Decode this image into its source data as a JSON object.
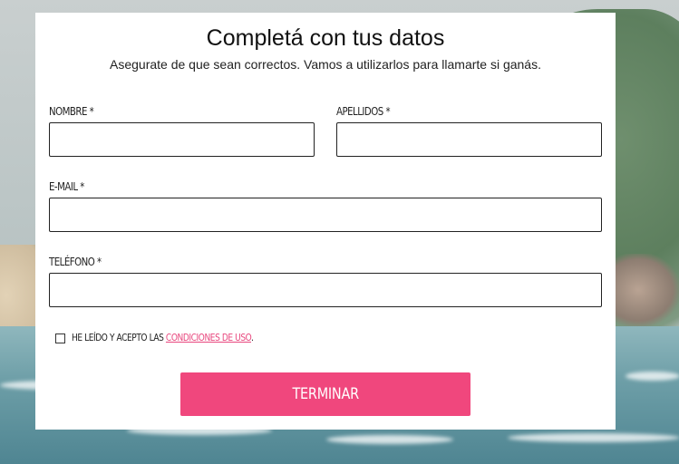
{
  "form": {
    "title": "Completá con tus datos",
    "subtitle": "Asegurate de que sean correctos. Vamos a utilizarlos para llamarte si ganás.",
    "fields": {
      "nombre": {
        "label": "NOMBRE *",
        "value": "",
        "placeholder": ""
      },
      "apellidos": {
        "label": "APELLIDOS *",
        "value": "",
        "placeholder": ""
      },
      "email": {
        "label": "E-MAIL *",
        "value": "",
        "placeholder": ""
      },
      "telefono": {
        "label": "TELÉFONO *",
        "value": "",
        "placeholder": ""
      }
    },
    "terms": {
      "prefix": "HE LEÍDO Y ACEPTO LAS ",
      "link_text": "CONDICIONES DE USO",
      "suffix": ".",
      "checked": false
    },
    "submit_label": "TERMINAR"
  },
  "colors": {
    "accent": "#f0477d",
    "link": "#e8467d",
    "card_background": "#ffffff"
  }
}
